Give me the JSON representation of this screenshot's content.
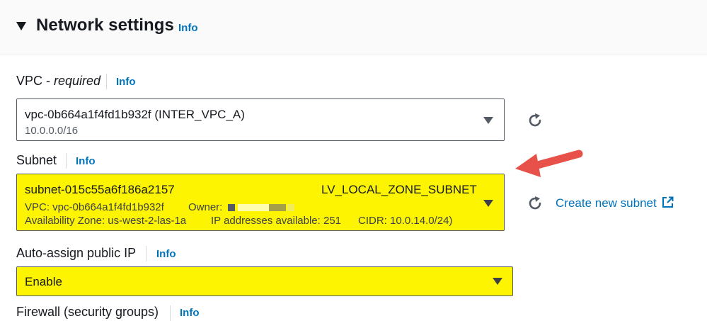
{
  "section": {
    "title": "Network settings",
    "info": "Info"
  },
  "vpc": {
    "label": "VPC - ",
    "label_required": "required",
    "info": "Info",
    "value": "vpc-0b664a1f4fd1b932f (INTER_VPC_A)",
    "cidr": "10.0.0.0/16"
  },
  "subnet": {
    "label": "Subnet",
    "info": "Info",
    "value": "subnet-015c55a6f186a2157",
    "name": "LV_LOCAL_ZONE_SUBNET",
    "vpc": "VPC: vpc-0b664a1f4fd1b932f",
    "owner_label": "Owner:",
    "availability_zone": "Availability Zone: us-west-2-las-1a",
    "ip_available": "IP addresses available: 251",
    "cidr": "CIDR: 10.0.14.0/24)",
    "create_link": "Create new subnet"
  },
  "public_ip": {
    "label": "Auto-assign public IP",
    "info": "Info",
    "value": "Enable"
  },
  "firewall": {
    "label": "Firewall (security groups)",
    "info": "Info"
  },
  "colors": {
    "highlight": "#fcf400",
    "link": "#0073bb",
    "arrow": "#e8514a"
  }
}
